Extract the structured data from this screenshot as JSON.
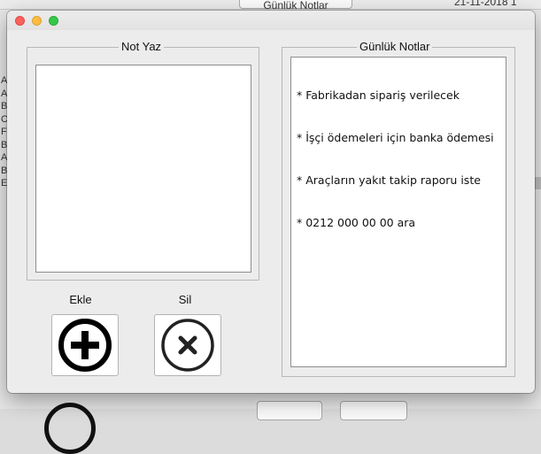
{
  "background": {
    "top_button_label": "Günlük Notlar",
    "date_text": "21-11-2018 1",
    "left_letters": [
      "A",
      "A",
      "B",
      "C",
      "F",
      "B",
      "A",
      "B",
      "E"
    ]
  },
  "dialog": {
    "note_panel": {
      "title": "Not Yaz",
      "input_value": ""
    },
    "notes_panel": {
      "title": "Günlük Notlar",
      "lines": [
        "* Fabrikadan sipariş verilecek",
        "* İşçi ödemeleri için banka ödemesi",
        "* Araçların yakıt takip raporu iste",
        "* 0212 000 00 00 ara"
      ]
    },
    "add": {
      "label": "Ekle",
      "icon": "plus-circle-icon"
    },
    "delete": {
      "label": "Sil",
      "icon": "x-circle-icon"
    }
  },
  "colors": {
    "close": "#fc605c",
    "minimize": "#fdbc40",
    "maximize": "#34c84a"
  }
}
